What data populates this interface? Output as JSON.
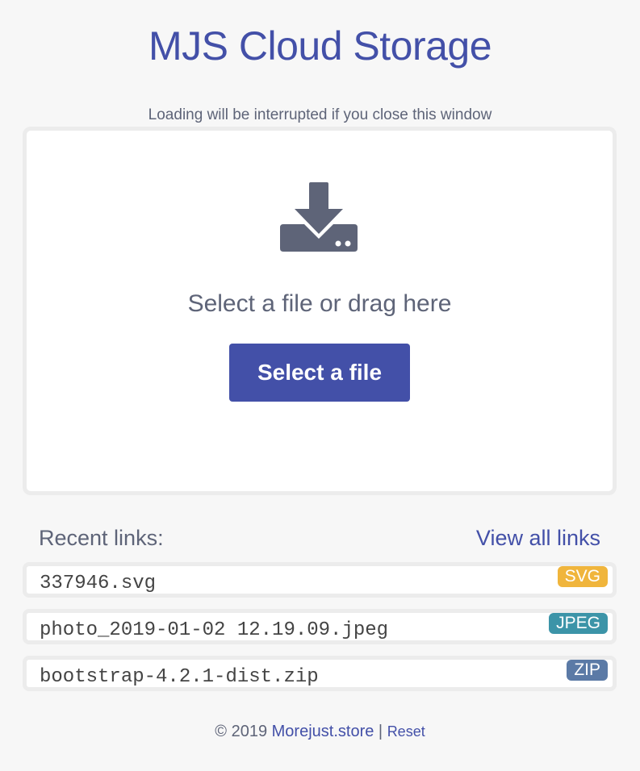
{
  "header": {
    "title": "MJS Cloud Storage",
    "notice": "Loading will be interrupted if you close this window"
  },
  "dropzone": {
    "icon": "download-tray-icon",
    "prompt": "Select a file or drag here",
    "button_label": "Select a file"
  },
  "recent": {
    "label": "Recent links:",
    "view_all": "View all links",
    "items": [
      {
        "name": "337946.svg",
        "type": "SVG",
        "color": "#f0b53c"
      },
      {
        "name": "photo_2019-01-02 12.19.09.jpeg",
        "type": "JPEG",
        "color": "#3c94a8"
      },
      {
        "name": "bootstrap-4.2.1-dist.zip",
        "type": "ZIP",
        "color": "#5b7aa6"
      }
    ]
  },
  "footer": {
    "copyright": "© 2019",
    "site": "Morejust.store",
    "separator": "|",
    "reset": "Reset"
  },
  "colors": {
    "accent": "#4350a8",
    "text_muted": "#5e6478",
    "background": "#f7f7f7"
  }
}
